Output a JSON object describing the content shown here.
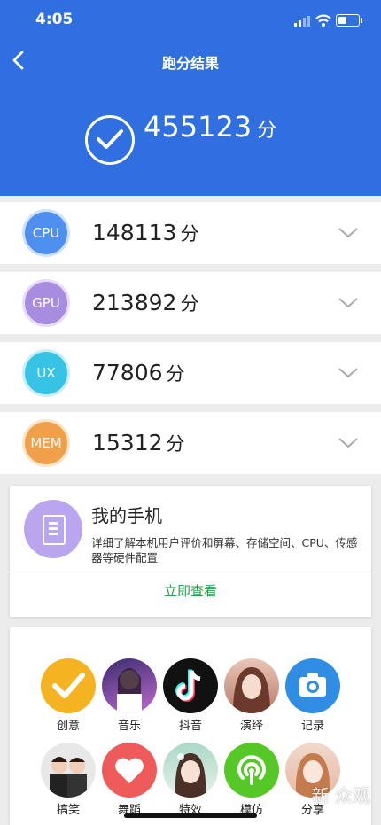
{
  "status": {
    "time": "4:05"
  },
  "header": {
    "title": "跑分结果",
    "total_score": "455123",
    "unit": "分"
  },
  "scores": [
    {
      "name": "CPU",
      "value": "148113",
      "unit": "分",
      "color": "#4f8ff0",
      "ring": "#cfe0fb"
    },
    {
      "name": "GPU",
      "value": "213892",
      "unit": "分",
      "color": "#a78ce0",
      "ring": "#e6dcf7"
    },
    {
      "name": "UX",
      "value": "77806",
      "unit": "分",
      "color": "#36c3e6",
      "ring": "#c8eef8"
    },
    {
      "name": "MEM",
      "value": "15312",
      "unit": "分",
      "color": "#f0a04b",
      "ring": "#fbe3c6"
    }
  ],
  "my_phone": {
    "title": "我的手机",
    "desc": "详细了解本机用户评价和屏幕、存储空间、CPU、传感器等硬件配置",
    "action": "立即查看"
  },
  "apps": [
    {
      "label": "创意",
      "icon": "checkmark-icon"
    },
    {
      "label": "音乐",
      "icon": "music-avatar-icon"
    },
    {
      "label": "抖音",
      "icon": "douyin-icon"
    },
    {
      "label": "演绎",
      "icon": "performer-avatar-icon"
    },
    {
      "label": "记录",
      "icon": "camera-icon"
    },
    {
      "label": "搞笑",
      "icon": "comedy-avatar-icon"
    },
    {
      "label": "舞蹈",
      "icon": "heart-icon"
    },
    {
      "label": "特效",
      "icon": "effects-avatar-icon"
    },
    {
      "label": "模仿",
      "icon": "imitate-icon"
    },
    {
      "label": "分享",
      "icon": "share-avatar-icon"
    }
  ],
  "watermark": "新 众观"
}
